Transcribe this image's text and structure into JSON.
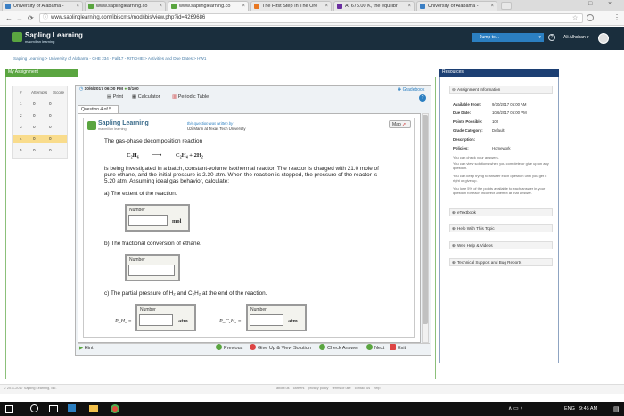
{
  "browser": {
    "tabs": [
      {
        "label": "University of Alabama -",
        "active": false,
        "color": "#3b7fc4"
      },
      {
        "label": "www.saplinglearning.co",
        "active": false,
        "color": "#5aa540"
      },
      {
        "label": "www.saplinglearning.co",
        "active": true,
        "color": "#5aa540"
      },
      {
        "label": "The First Step In The Ore",
        "active": false,
        "color": "#e87722"
      },
      {
        "label": "At 675.00 K, the equilibr",
        "active": false,
        "color": "#6b2fa0"
      },
      {
        "label": "University of Alabama -",
        "active": false,
        "color": "#3b7fc4"
      }
    ],
    "url": "www.saplinglearning.com/ibiscms/mod/ibis/view.php?id=4269686"
  },
  "header": {
    "logo": "Sapling Learning",
    "logo_sub": "macmillan learning",
    "jump_label": "Jump to...",
    "user": "Ali Alhshan"
  },
  "breadcrumb": "Sapling Learning  >  University of Alabama - CHE 234 - Fall17 - RITCHIE  >  Activities and Due Dates  >  HW1",
  "my_assignment": {
    "title": "My Assignment",
    "columns": [
      "#",
      "Attempts",
      "Score"
    ],
    "rows": [
      {
        "n": "1",
        "attempts": "0",
        "score": "0"
      },
      {
        "n": "2",
        "attempts": "0",
        "score": "0"
      },
      {
        "n": "3",
        "attempts": "0",
        "score": "0"
      },
      {
        "n": "4",
        "attempts": "0",
        "score": "0"
      },
      {
        "n": "5",
        "attempts": "0",
        "score": "0"
      }
    ]
  },
  "toolbar": {
    "due": "10/6/2017 06:00 PM",
    "score": "0/100",
    "print": "Print",
    "calculator": "Calculator",
    "periodic": "Periodic Table",
    "gradebook": "Gradebook"
  },
  "question": {
    "tab": "Question 4 of 5",
    "brand": "Sapling Learning",
    "brand_sub": "macmillan learning",
    "author1": "this question was written by",
    "author2": "Uzi Mann at Texas Tech University",
    "map": "Map",
    "intro": "The gas-phase decomposition reaction",
    "reaction_left": "C₂H₆",
    "reaction_arrow": "⟶",
    "reaction_right": "C₂H₄ + 2H₂",
    "para1": "is being investigated in a batch, constant-volume isothermal reactor. The reactor is charged with 21.0 mole of",
    "para2": "pure ethane, and the initial pressure is 2.30 atm. When the reaction is stopped, the pressure of the reactor is",
    "para3": "5.20 atm. Assuming ideal gas behavior, calculate:",
    "part_a": "a) The extent of the reaction.",
    "part_b": "b) The fractional conversion of ethane.",
    "part_c": "c) The partial pressure of H₂ and C₂H₂ at the end of the reaction.",
    "number_label": "Number",
    "unit_mol": "mol",
    "unit_atm": "atm",
    "p_h2": "P_H₂ =",
    "p_c2h2": "P_C₂H₂ ="
  },
  "bottom": {
    "hint": "Hint",
    "previous": "Previous",
    "giveup": "Give Up & View Solution",
    "check": "Check Answer",
    "next": "Next",
    "exit": "Exit"
  },
  "resources": {
    "title": "Resources",
    "assignment_info": "Assignment Information",
    "available_k": "Available From:",
    "available_v": "9/30/2017 06:00 AM",
    "due_k": "Due Date:",
    "due_v": "10/6/2017 06:00 PM",
    "points_k": "Points Possible:",
    "points_v": "100",
    "grade_k": "Grade Category:",
    "grade_v": "Default",
    "desc_k": "Description:",
    "policies_k": "Policies:",
    "policies_v": "Homework",
    "note1": "You can check your answers.",
    "note2": "You can view solutions when you complete or give up on any question.",
    "note3": "You can keep trying to answer each question until you get it right or give up.",
    "note4": "You lose 5% of the points available to each answer in your question for each incorrect attempt at that answer.",
    "etextbook": "eTextbook",
    "help_topic": "Help With This Topic",
    "web_help": "Web Help & Videos",
    "support": "Technical Support and Bug Reports"
  },
  "footer": {
    "copyright": "© 2011-2017 Sapling Learning, Inc.",
    "links": "about us    careers    privacy policy    terms of use    contact us    help"
  },
  "taskbar": {
    "lang": "ENG",
    "time": "9:45 AM"
  }
}
